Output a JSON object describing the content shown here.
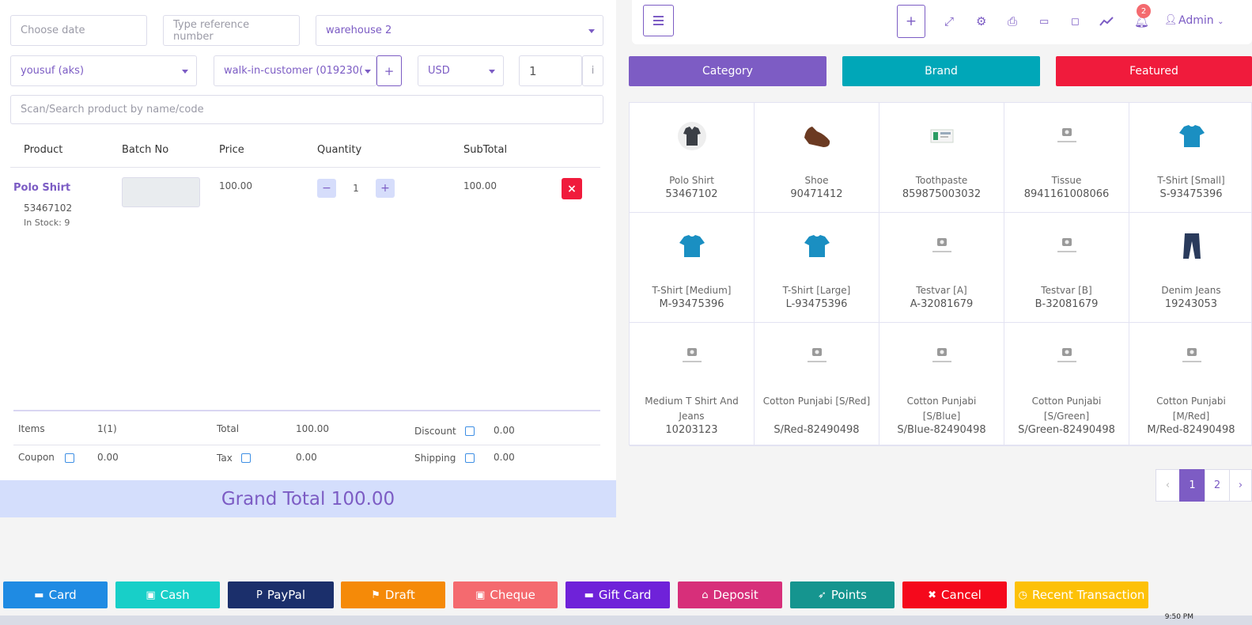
{
  "form": {
    "date_placeholder": "Choose date",
    "reference_placeholder": "Type reference number",
    "warehouse": "warehouse 2",
    "biller": "yousuf (aks)",
    "customer": "walk-in-customer (019230(",
    "currency": "USD",
    "exchange_rate": "1",
    "info_icon_text": "i",
    "search_placeholder": "Scan/Search product by name/code"
  },
  "table": {
    "headers": [
      "Product",
      "Batch No",
      "Price",
      "Quantity",
      "SubTotal"
    ],
    "rows": [
      {
        "name": "Polo Shirt",
        "code": "53467102",
        "stock": "In Stock: 9",
        "price": "100.00",
        "qty": "1",
        "subtotal": "100.00"
      }
    ]
  },
  "totals": {
    "items_label": "Items",
    "items_value": "1(1)",
    "total_label": "Total",
    "total_value": "100.00",
    "discount_label": "Discount",
    "discount_value": "0.00",
    "coupon_label": "Coupon",
    "coupon_value": "0.00",
    "tax_label": "Tax",
    "tax_value": "0.00",
    "shipping_label": "Shipping",
    "shipping_value": "0.00",
    "grand_total": "Grand Total 100.00"
  },
  "topbar": {
    "notification_count": "2",
    "user": "Admin",
    "icons": [
      "menu-icon",
      "plus-icon",
      "fullscreen-icon",
      "gear-icon",
      "printer-icon",
      "briefcase-icon",
      "shopping-bag-icon",
      "line-chart-icon",
      "bell-icon",
      "user-icon"
    ]
  },
  "tabs": [
    {
      "label": "Category",
      "color": "#7d5cc4"
    },
    {
      "label": "Brand",
      "color": "#00a7b8"
    },
    {
      "label": "Featured",
      "color": "#f01b3c"
    }
  ],
  "products": [
    {
      "name": "Polo Shirt",
      "code": "53467102",
      "img": "polo"
    },
    {
      "name": "Shoe",
      "code": "90471412",
      "img": "shoe"
    },
    {
      "name": "Toothpaste",
      "code": "859875003032",
      "img": "toothpaste"
    },
    {
      "name": "Tissue",
      "code": "8941161008066",
      "img": "placeholder"
    },
    {
      "name": "T-Shirt [Small]",
      "code": "S-93475396",
      "img": "tshirt"
    },
    {
      "name": "T-Shirt [Medium]",
      "code": "M-93475396",
      "img": "tshirt"
    },
    {
      "name": "T-Shirt [Large]",
      "code": "L-93475396",
      "img": "tshirt"
    },
    {
      "name": "Testvar [A]",
      "code": "A-32081679",
      "img": "placeholder"
    },
    {
      "name": "Testvar [B]",
      "code": "B-32081679",
      "img": "placeholder"
    },
    {
      "name": "Denim Jeans",
      "code": "19243053",
      "img": "jeans"
    },
    {
      "name": "Medium T Shirt And Jeans",
      "code": "10203123",
      "img": "placeholder"
    },
    {
      "name": "Cotton Punjabi [S/Red]",
      "code": "S/Red-82490498",
      "img": "placeholder"
    },
    {
      "name": "Cotton Punjabi [S/Blue]",
      "code": "S/Blue-82490498",
      "img": "placeholder"
    },
    {
      "name": "Cotton Punjabi [S/Green]",
      "code": "S/Green-82490498",
      "img": "placeholder"
    },
    {
      "name": "Cotton Punjabi [M/Red]",
      "code": "M/Red-82490498",
      "img": "placeholder"
    }
  ],
  "pagination": {
    "prev": "‹",
    "pages": [
      "1",
      "2"
    ],
    "next": "›",
    "active": "1"
  },
  "payments": [
    {
      "label": "Card",
      "color": "#1f8be3",
      "icon": "credit-card-icon"
    },
    {
      "label": "Cash",
      "color": "#18cfc8",
      "icon": "money-icon"
    },
    {
      "label": "PayPal",
      "color": "#1b2f6b",
      "icon": "paypal-icon"
    },
    {
      "label": "Draft",
      "color": "#f58a08",
      "icon": "flag-icon"
    },
    {
      "label": "Cheque",
      "color": "#f46a6f",
      "icon": "money-icon"
    },
    {
      "label": "Gift Card",
      "color": "#6f22d9",
      "icon": "credit-card-icon"
    },
    {
      "label": "Deposit",
      "color": "#d72f7a",
      "icon": "bank-icon"
    },
    {
      "label": "Points",
      "color": "#15958f",
      "icon": "rocket-icon"
    },
    {
      "label": "Cancel",
      "color": "#f5091c",
      "icon": "close-icon"
    },
    {
      "label": "Recent Transaction",
      "color": "#fdc107",
      "icon": "clock-icon"
    }
  ],
  "taskbar": {
    "time": "9:50 PM"
  }
}
